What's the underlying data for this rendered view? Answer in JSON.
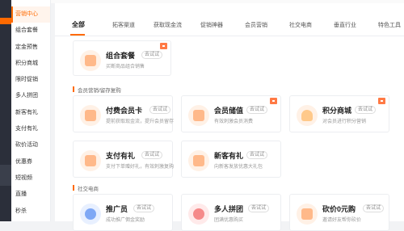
{
  "sidebar": {
    "items": [
      {
        "label": "营销中心"
      },
      {
        "label": "组合套餐"
      },
      {
        "label": "定金预售"
      },
      {
        "label": "积分商城"
      },
      {
        "label": "限时促销"
      },
      {
        "label": "多人拼团"
      },
      {
        "label": "新客有礼"
      },
      {
        "label": "支付有礼"
      },
      {
        "label": "砍价活动"
      },
      {
        "label": "优惠券"
      },
      {
        "label": "短视频"
      },
      {
        "label": "直播"
      },
      {
        "label": "秒杀"
      }
    ]
  },
  "tabs": [
    {
      "label": "全部"
    },
    {
      "label": "拓客渠道"
    },
    {
      "label": "获取现金流"
    },
    {
      "label": "促销神器"
    },
    {
      "label": "会员营销"
    },
    {
      "label": "社交电商"
    },
    {
      "label": "垂直行业"
    },
    {
      "label": "特色工具"
    }
  ],
  "sections": {
    "member": "会员营销/留存复购",
    "social": "社交电商"
  },
  "cards": {
    "combo": {
      "title": "组合套餐",
      "badge": "去试试",
      "desc": "买断商品组合销售"
    },
    "paid_member": {
      "title": "付费会员卡",
      "badge": "去试试",
      "desc": "提前获取现金流，提升会员留存"
    },
    "stored_value": {
      "title": "会员储值",
      "badge": "去试试",
      "desc": "有效刺激会员消费"
    },
    "points_mall": {
      "title": "积分商城",
      "badge": "去试试",
      "desc": "对会员进行积分营销"
    },
    "pay_gift": {
      "title": "支付有礼",
      "badge": "去试试",
      "desc": "支付下单赠好礼，有效刺激复购"
    },
    "new_gift": {
      "title": "新客有礼",
      "badge": "去试试",
      "desc": "向新客发放优惠大礼包"
    },
    "promoter": {
      "title": "推广员",
      "badge": "去试试",
      "desc": "成功推广佣金奖励"
    },
    "group_buy": {
      "title": "多人拼团",
      "badge": "去试试",
      "desc": "团满优惠购买"
    },
    "bargain": {
      "title": "砍价0元购",
      "badge": "去试试",
      "desc": "邀请好友帮你砍价"
    }
  }
}
